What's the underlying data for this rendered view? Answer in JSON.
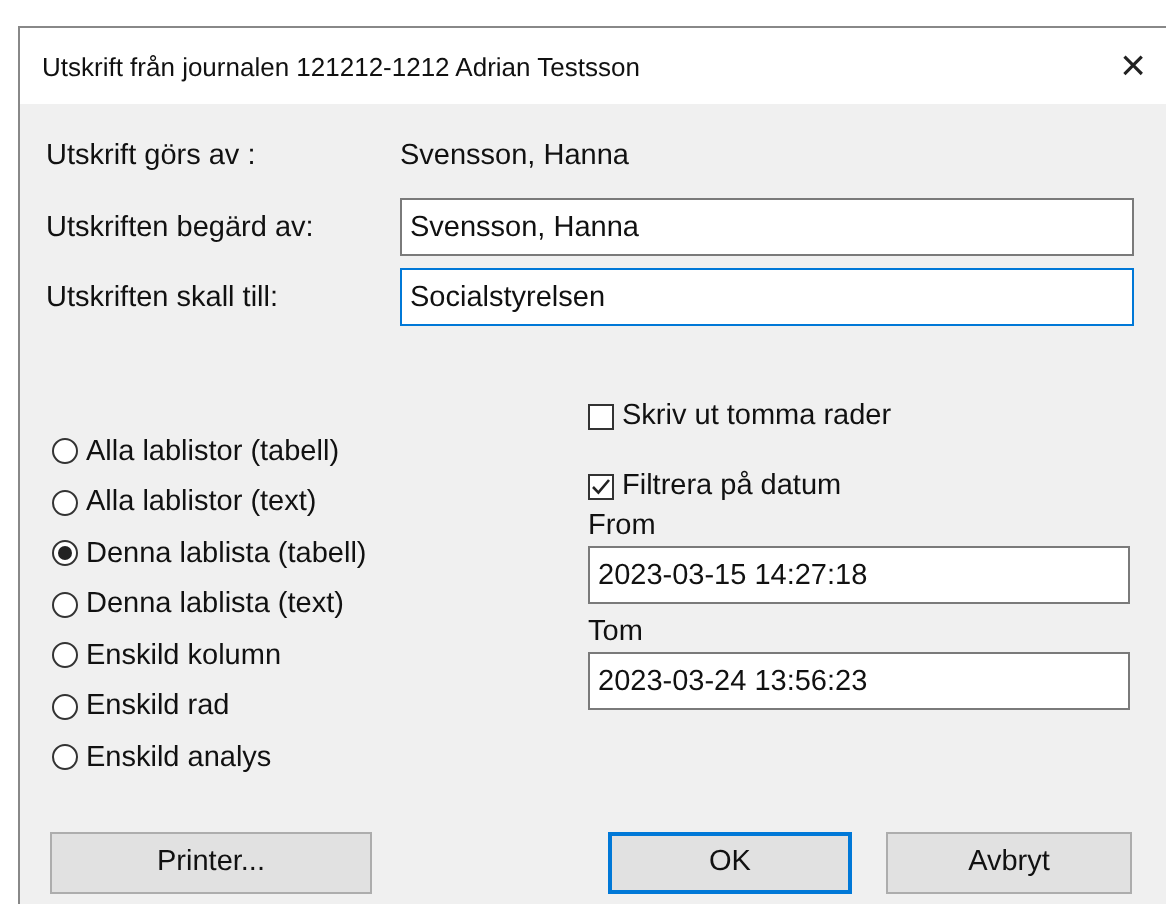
{
  "window": {
    "title": "Utskrift från journalen 121212-1212 Adrian Testsson",
    "close": "×"
  },
  "printed_by": {
    "label": "Utskrift görs av :",
    "value": "Svensson, Hanna"
  },
  "fields": [
    {
      "label": "Utskriften begärd av:",
      "value": "Svensson, Hanna",
      "focused": false
    },
    {
      "label": "Utskriften skall till:",
      "value": "Socialstyrelsen",
      "focused": true
    }
  ],
  "options": [
    {
      "label": "Alla lablistor (tabell)",
      "selected": false
    },
    {
      "label": "Alla lablistor (text)",
      "selected": false
    },
    {
      "label": "Denna lablista (tabell)",
      "selected": true
    },
    {
      "label": "Denna lablista (text)",
      "selected": false
    },
    {
      "label": "Enskild kolumn",
      "selected": false
    },
    {
      "label": "Enskild rad",
      "selected": false
    },
    {
      "label": "Enskild analys",
      "selected": false
    }
  ],
  "print_empty_rows": {
    "label": "Skriv ut tomma rader",
    "checked": false
  },
  "filter_by_date": {
    "label": "Filtrera på datum",
    "checked": true
  },
  "from": {
    "label": "From",
    "value": "2023-03-15 14:27:18"
  },
  "to": {
    "label": "Tom",
    "value": "2023-03-24 13:56:23"
  },
  "buttons": [
    {
      "label": "Printer...",
      "default": false
    },
    {
      "label": "OK",
      "default": true
    },
    {
      "label": "Avbryt",
      "default": false
    }
  ]
}
